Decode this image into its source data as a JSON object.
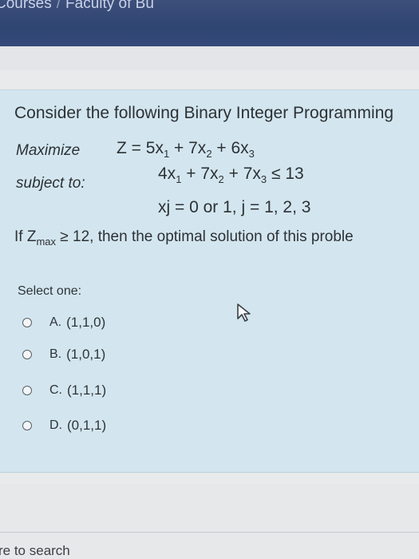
{
  "breadcrumb": {
    "item1": "Courses",
    "separator": "/",
    "item2": "Faculty of Bu"
  },
  "question": {
    "intro": "Consider the following Binary Integer Programming",
    "objective_label": "Maximize",
    "objective": {
      "lhs": "Z = 5x",
      "t1_sub": "1",
      "mid1": " + 7x",
      "t2_sub": "2",
      "mid2": " + 6x",
      "t3_sub": "3"
    },
    "constraint_label": "subject to:",
    "constraint": {
      "a": "4x",
      "a_sub": "1",
      "b": " + 7x",
      "b_sub": "2",
      "c": " + 7x",
      "c_sub": "3",
      "rhs": " ≤ 13"
    },
    "domain_line": "xj = 0 or 1,  j = 1, 2, 3",
    "condition": {
      "pre": "If Z",
      "sub": "max",
      "post": " ≥ 12, then the optimal solution of this proble"
    }
  },
  "select_label": "Select one:",
  "options": [
    {
      "letter": "A.",
      "text": "(1,1,0)"
    },
    {
      "letter": "B.",
      "text": "(1,0,1)"
    },
    {
      "letter": "C.",
      "text": "(1,1,1)"
    },
    {
      "letter": "D.",
      "text": "(0,1,1)"
    }
  ],
  "taskbar": {
    "search_placeholder": "re to search"
  },
  "colors": {
    "header": "#2f4572",
    "card": "#d3e6ef",
    "page": "#e9eaec"
  }
}
